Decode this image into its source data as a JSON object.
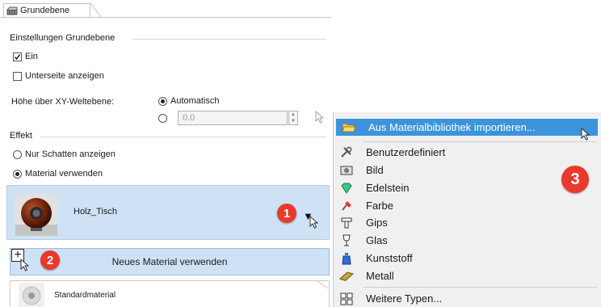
{
  "tab": {
    "label": "Grundebene"
  },
  "settings": {
    "group_title": "Einstellungen Grundebene",
    "ein_label": "Ein",
    "ein_checked": true,
    "unterseite_label": "Unterseite anzeigen",
    "unterseite_checked": false,
    "height_label": "Höhe über XY-Weltebene:",
    "height_auto_label": "Automatisch",
    "height_value": "0.0"
  },
  "effekt": {
    "group_title": "Effekt",
    "shadow_label": "Nur Schatten anzeigen",
    "material_label": "Material verwenden"
  },
  "material": {
    "name": "Holz_Tisch",
    "new_button_label": "Neues Material verwenden",
    "list_item": "Standardmaterial"
  },
  "badges": {
    "b1": "1",
    "b2": "2",
    "b3": "3"
  },
  "menu": {
    "import_label": "Aus Materialbibliothek importieren...",
    "items": [
      {
        "label": "Benutzerdefiniert",
        "icon": "wrench-icon"
      },
      {
        "label": "Bild",
        "icon": "image-icon"
      },
      {
        "label": "Edelstein",
        "icon": "gem-icon"
      },
      {
        "label": "Farbe",
        "icon": "paint-icon"
      },
      {
        "label": "Gips",
        "icon": "plaster-icon"
      },
      {
        "label": "Glas",
        "icon": "glass-icon"
      },
      {
        "label": "Kunststoff",
        "icon": "plastic-icon"
      },
      {
        "label": "Metall",
        "icon": "metal-icon"
      }
    ],
    "more_label": "Weitere Typen..."
  },
  "colors": {
    "highlight": "#3b94dc",
    "card": "#cfe2f5",
    "badge": "#e8392b"
  }
}
